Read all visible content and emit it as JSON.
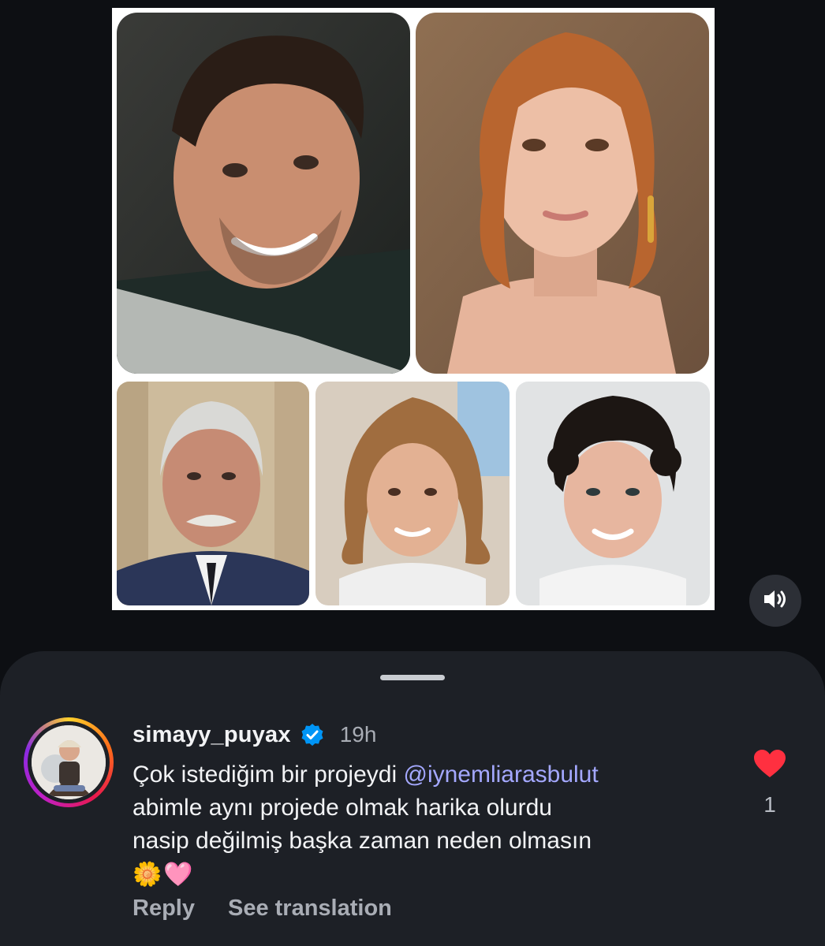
{
  "media": {
    "photos": [
      {
        "name": "man-portrait-photo"
      },
      {
        "name": "woman-portrait-photo"
      },
      {
        "name": "older-man-portrait-photo"
      },
      {
        "name": "girl-portrait-photo"
      },
      {
        "name": "boy-portrait-photo"
      }
    ],
    "sound_icon": "speaker-volume-icon"
  },
  "comment": {
    "username": "simayy_puyax",
    "verified_icon": "verified-badge-icon",
    "timestamp": "19h",
    "text_line1_prefix": "Çok istediğim bir projeydi ",
    "mention_icon": "threads-at-icon",
    "mention_glyph": "@",
    "mention": "iynemliarasbulut",
    "text_line2": "abimle aynı projede olmak harika olurdu",
    "text_line3": "nasip değilmiş başka zaman neden olmasın",
    "emojis": [
      "🌼",
      "🩷"
    ],
    "reply_label": "Reply",
    "translate_label": "See translation",
    "like_icon": "heart-icon",
    "like_count": "1",
    "colors": {
      "accent_mention": "#a4a8ff",
      "like": "#ff3040",
      "verified": "#0095f6"
    }
  }
}
